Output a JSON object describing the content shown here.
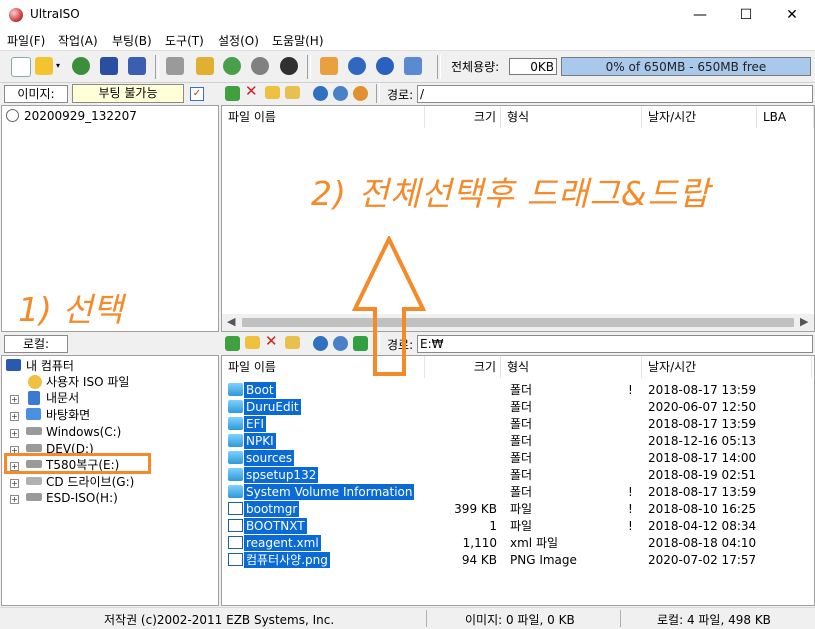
{
  "window": {
    "title": "UltraISO",
    "minimize": "—",
    "maximize": "☐",
    "close": "✕"
  },
  "menu": [
    "파일(F)",
    "작업(A)",
    "부팅(B)",
    "도구(T)",
    "설정(O)",
    "도움말(H)"
  ],
  "toolbar": {
    "total_label": "전체용량:",
    "total_value": "0KB",
    "capacity": "0% of 650MB - 650MB free",
    "capacity_fraction": 0
  },
  "image_panel": {
    "label": "이미지:",
    "boot_value": "부팅 불가능",
    "tree_root": "20200929_132207"
  },
  "iso_panel": {
    "path_label": "경로:",
    "path_value": "/",
    "columns": [
      "파일 이름",
      "크기",
      "형식",
      "날자/시간",
      "LBA"
    ]
  },
  "local_panel": {
    "label": "로컬:",
    "path_label": "경로:",
    "path_value": "E:₩",
    "columns": [
      "파일 이름",
      "크기",
      "형식",
      "날자/시간"
    ],
    "tree": [
      "내 컴퓨터",
      "사용자 ISO 파일",
      "내문서",
      "바탕화면",
      "Windows(C:)",
      "DEV(D:)",
      "T580복구(E:)",
      "CD 드라이브(G:)",
      "ESD-ISO(H:)"
    ],
    "files": [
      {
        "name": "Boot",
        "size": "",
        "type": "폴더",
        "flag": "!",
        "date": "2018-08-17 13:59",
        "kind": "folder"
      },
      {
        "name": "DuruEdit",
        "size": "",
        "type": "폴더",
        "flag": "",
        "date": "2020-06-07 12:50",
        "kind": "folder"
      },
      {
        "name": "EFI",
        "size": "",
        "type": "폴더",
        "flag": "",
        "date": "2018-08-17 13:59",
        "kind": "folder"
      },
      {
        "name": "NPKI",
        "size": "",
        "type": "폴더",
        "flag": "",
        "date": "2018-12-16 05:13",
        "kind": "folder"
      },
      {
        "name": "sources",
        "size": "",
        "type": "폴더",
        "flag": "",
        "date": "2018-08-17 14:00",
        "kind": "folder"
      },
      {
        "name": "spsetup132",
        "size": "",
        "type": "폴더",
        "flag": "",
        "date": "2018-08-19 02:51",
        "kind": "folder"
      },
      {
        "name": "System Volume Information",
        "size": "",
        "type": "폴더",
        "flag": "!",
        "date": "2018-08-17 13:59",
        "kind": "folder"
      },
      {
        "name": "bootmgr",
        "size": "399 KB",
        "type": "파일",
        "flag": "!",
        "date": "2018-08-10 16:25",
        "kind": "file"
      },
      {
        "name": "BOOTNXT",
        "size": "1",
        "type": "파일",
        "flag": "!",
        "date": "2018-04-12 08:34",
        "kind": "file"
      },
      {
        "name": "reagent.xml",
        "size": "1,110",
        "type": "xml 파일",
        "flag": "",
        "date": "2018-08-18 04:10",
        "kind": "file"
      },
      {
        "name": "컴퓨터사양.png",
        "size": "94 KB",
        "type": "PNG Image",
        "flag": "",
        "date": "2020-07-02 17:57",
        "kind": "file"
      }
    ]
  },
  "status": {
    "copyright": "저작권 (c)2002-2011 EZB Systems, Inc.",
    "image": "이미지: 0 파일, 0 KB",
    "local": "로컬: 4 파일, 498 KB"
  },
  "annotations": {
    "step1": "1) 선택",
    "step2": "2) 전체선택후 드래그&드랍"
  },
  "colors": {
    "selection": "#0a6bd6",
    "annotation": "#f58a2a",
    "capacity_bar": "#a8c8ec"
  }
}
